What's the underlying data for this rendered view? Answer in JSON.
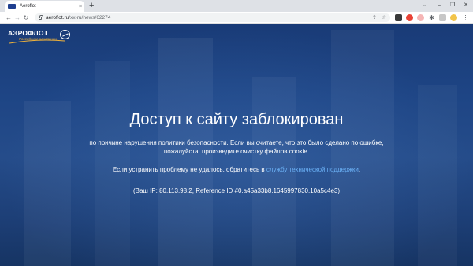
{
  "browser": {
    "tab_title": "Aeroflot",
    "tab_close": "×",
    "new_tab": "+",
    "url_host": "aeroflot.ru",
    "url_path": "/xx-ru/news/62274",
    "window_controls": {
      "chevron": "⌄",
      "minimize": "–",
      "maximize": "❐",
      "close": "✕"
    },
    "nav": {
      "back": "←",
      "forward": "→",
      "reload": "↻"
    },
    "omnibox_icons": {
      "share": "⇪",
      "bookmark": "☆"
    },
    "extensions_menu": "⋮",
    "puzzle": "✱"
  },
  "page": {
    "logo": {
      "text": "АЭРОФЛОТ",
      "subtitle": "Российские авиалинии"
    },
    "title": "Доступ к сайту заблокирован",
    "message_line1": "по причине нарушения политики безопасности. Если вы считаете, что это было сделано по ошибке,",
    "message_line2": "пожалуйста, произведите очистку файлов cookie.",
    "support_prefix": "Если устранить проблему не удалось, обратитесь в ",
    "support_link": "службу технической поддержки",
    "support_suffix": ".",
    "reference": "(Ваш IP: 80.113.98.2, Reference ID #0.a45a33b8.1645997830.10a5c4e3)"
  },
  "colors": {
    "link": "#6ab0f5",
    "brand_orange": "#f0b23a",
    "background": "#1e4585"
  }
}
